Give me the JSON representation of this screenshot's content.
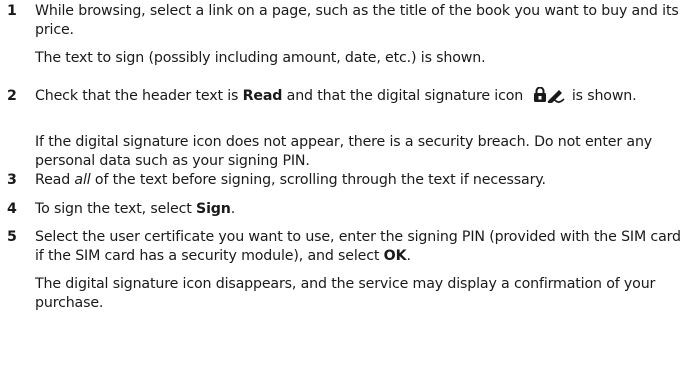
{
  "steps": [
    {
      "number": "1",
      "text": "While browsing, select a link on a page, such as the title of the book you want to buy and its price.",
      "note": "The text to sign (possibly including amount, date, etc.) is shown."
    },
    {
      "number": "2",
      "text_before": "Check that the header text is ",
      "bold_header": "Read",
      "text_middle": " and that the digital signature icon ",
      "text_after": " is shown.",
      "icon": "lock-pen-signature-icon",
      "note": "If the digital signature icon does not appear, there is a security breach. Do not enter any personal data such as your signing PIN."
    },
    {
      "number": "3",
      "text_before": "Read ",
      "italic_word": "all",
      "text_after": " of the text before signing, scrolling through the text if necessary."
    },
    {
      "number": "4",
      "text_before": "To sign the text, select ",
      "bold_word": "Sign",
      "text_after": "."
    },
    {
      "number": "5",
      "text_before": "Select the user certificate you want to use, enter the signing PIN (provided with the SIM card if the SIM card has a security module), and select ",
      "bold_word": "OK",
      "text_after": ".",
      "note": "The digital signature icon disappears, and the service may display a confirmation of your purchase."
    }
  ]
}
